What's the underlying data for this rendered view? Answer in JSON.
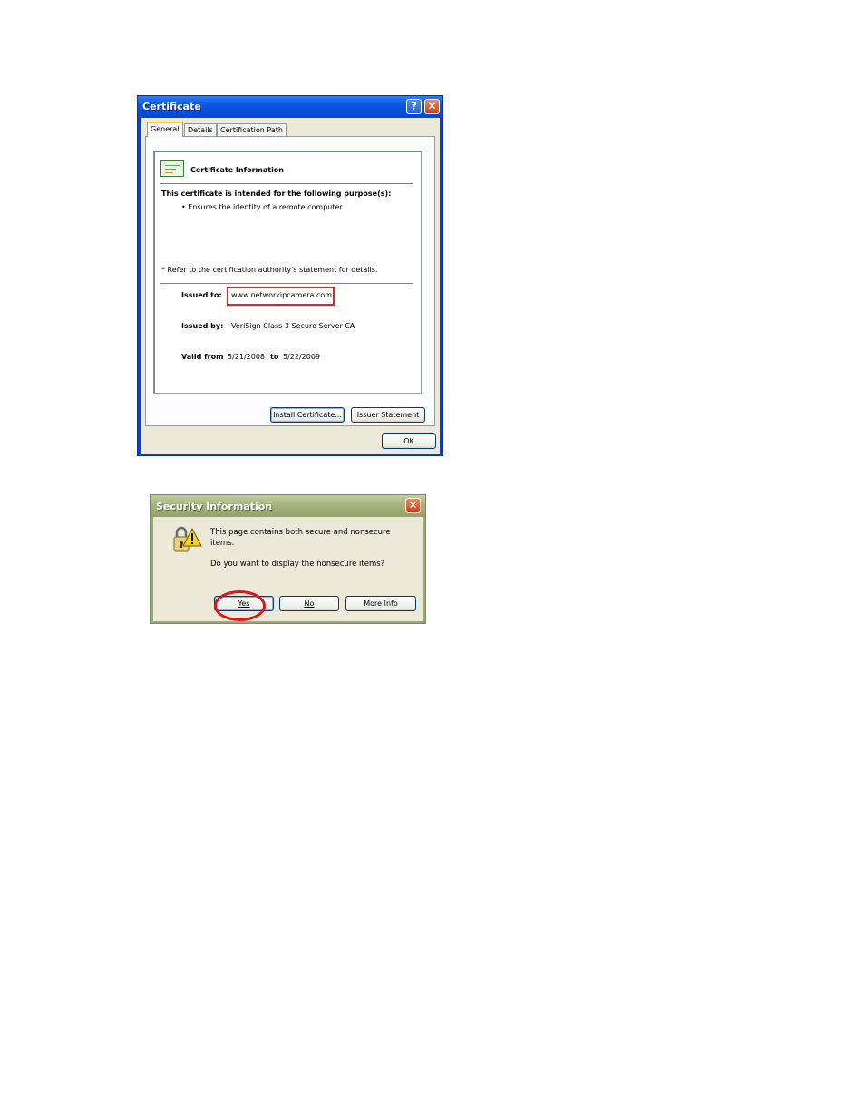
{
  "certificate_dialog": {
    "title": "Certificate",
    "help_symbol": "?",
    "close_symbol": "✕",
    "tabs": [
      {
        "label": "General",
        "active": true
      },
      {
        "label": "Details",
        "active": false
      },
      {
        "label": "Certification Path",
        "active": false
      }
    ],
    "info_heading": "Certificate Information",
    "purpose_heading": "This certificate is intended for the following purpose(s):",
    "purposes": [
      "• Ensures the identity of a remote computer"
    ],
    "footnote": "* Refer to the certification authority's statement for details.",
    "issued_to_label": "Issued to:",
    "issued_to_value": "www.networkipcamera.com",
    "issued_by_label": "Issued by:",
    "issued_by_value": "VeriSign Class 3 Secure Server CA",
    "valid_from_label": "Valid from",
    "valid_from_value": "5/21/2008",
    "valid_to_label": "to",
    "valid_to_value": "5/22/2009",
    "install_button": "Install Certificate...",
    "issuer_statement_button": "Issuer Statement",
    "ok_button": "OK",
    "icons": [
      "certificate-icon",
      "help-icon",
      "close-icon"
    ]
  },
  "security_dialog": {
    "title": "Security Information",
    "close_symbol": "✕",
    "message_line1": "This page contains both secure and nonsecure items.",
    "question": "Do you want to display the nonsecure items?",
    "yes_button": "Yes",
    "no_button": "No",
    "more_info_button": "More Info",
    "icons": [
      "lock-warning-icon",
      "close-icon"
    ]
  },
  "colors": {
    "xp_blue_title": "#0a55e2",
    "olive_title": "#a4b27c",
    "highlight_red": "#e0262c",
    "dialog_face": "#ece9d8"
  }
}
